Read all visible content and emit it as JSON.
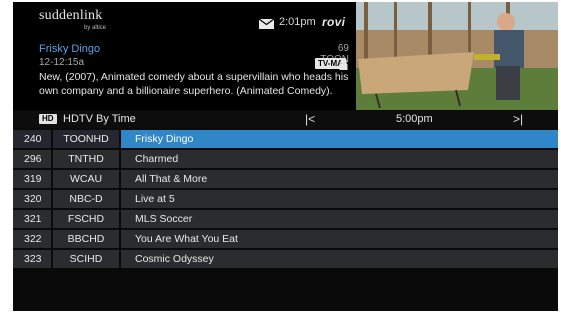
{
  "header": {
    "brand": "suddenlink",
    "brand_sub": "by altice",
    "mail_icon": "envelope-icon",
    "clock": "2:01pm",
    "guide_brand": "rovi"
  },
  "program": {
    "title": "Frisky Dingo",
    "time": "12-12:15a",
    "channel": "69 TOON",
    "rating": "TV-MA",
    "lock_icon": "lock-icon",
    "description": "New, (2007), Animated comedy about a supervillain who heads his own company and a billionaire superhero. (Animated Comedy)."
  },
  "timebar": {
    "hd_badge": "HD",
    "view_label": "HDTV By Time",
    "prev": "|<",
    "time_slot": "5:00pm",
    "next": ">|"
  },
  "guide": {
    "rows": [
      {
        "number": "240",
        "callsign": "TOONHD",
        "show": "Frisky Dingo",
        "selected": true
      },
      {
        "number": "296",
        "callsign": "TNTHD",
        "show": "Charmed",
        "selected": false
      },
      {
        "number": "319",
        "callsign": "WCAU",
        "show": "All That & More",
        "selected": false
      },
      {
        "number": "320",
        "callsign": "NBC-D",
        "show": "Live at 5",
        "selected": false
      },
      {
        "number": "321",
        "callsign": "FSCHD",
        "show": "MLS Soccer",
        "selected": false
      },
      {
        "number": "322",
        "callsign": "BBCHD",
        "show": "You Are What You Eat",
        "selected": false
      },
      {
        "number": "323",
        "callsign": "SCIHD",
        "show": "Cosmic Odyssey",
        "selected": false
      }
    ]
  },
  "colors": {
    "accent": "#2f87c8",
    "title_blue": "#5aa2e3",
    "row_bg": "#2a2c2f"
  }
}
